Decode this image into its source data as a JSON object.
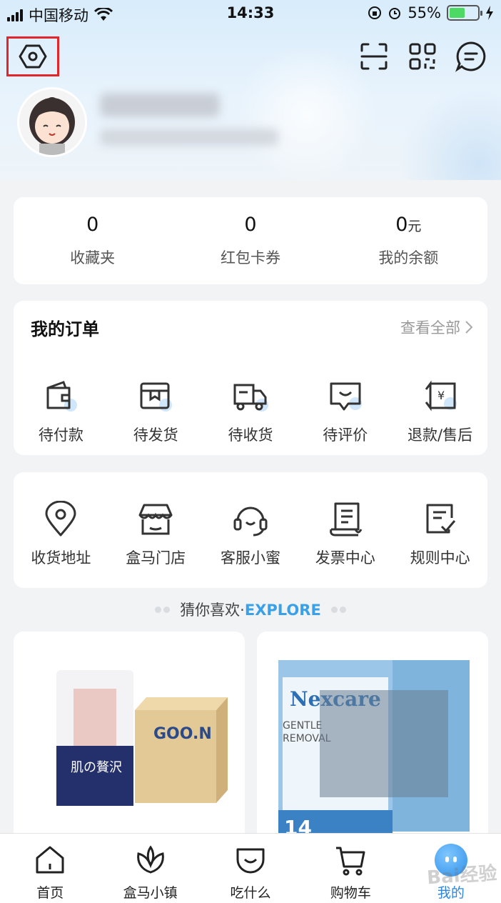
{
  "status_bar": {
    "carrier": "中国移动",
    "time": "14:33",
    "battery": "55%"
  },
  "header": {
    "settings_icon": "settings-hexagon-icon",
    "scan_icon": "scan-icon",
    "qr_icon": "qr-code-icon",
    "message_icon": "message-icon"
  },
  "stats": [
    {
      "value": "0",
      "unit": "",
      "label": "收藏夹"
    },
    {
      "value": "0",
      "unit": "",
      "label": "红包卡券"
    },
    {
      "value": "0",
      "unit": "元",
      "label": "我的余额"
    }
  ],
  "orders": {
    "title": "我的订单",
    "view_all": "查看全部",
    "items": [
      {
        "label": "待付款",
        "icon": "wallet-icon"
      },
      {
        "label": "待发货",
        "icon": "package-icon"
      },
      {
        "label": "待收货",
        "icon": "truck-icon"
      },
      {
        "label": "待评价",
        "icon": "review-icon"
      },
      {
        "label": "退款/售后",
        "icon": "refund-icon"
      }
    ]
  },
  "services": [
    {
      "label": "收货地址",
      "icon": "location-icon"
    },
    {
      "label": "盒马门店",
      "icon": "store-icon"
    },
    {
      "label": "客服小蜜",
      "icon": "headset-icon"
    },
    {
      "label": "发票中心",
      "icon": "invoice-icon"
    },
    {
      "label": "规则中心",
      "icon": "rules-icon"
    }
  ],
  "explore": {
    "cn": "猜你喜欢·",
    "en": "EXPLORE"
  },
  "products": [
    {
      "image": "diaper-pack-product-image"
    },
    {
      "image": "nexcare-eyepatch-product-image",
      "brand": "Nexcare"
    }
  ],
  "tabbar": [
    {
      "label": "首页",
      "icon": "home-icon"
    },
    {
      "label": "盒马小镇",
      "icon": "flower-icon"
    },
    {
      "label": "吃什么",
      "icon": "bowl-icon"
    },
    {
      "label": "购物车",
      "icon": "cart-icon"
    },
    {
      "label": "我的",
      "icon": "mascot-icon"
    }
  ],
  "colors": {
    "accent": "#2d86e0",
    "highlight_border": "#e0262b",
    "battery": "#4cd964"
  },
  "watermark": "Bai经验"
}
